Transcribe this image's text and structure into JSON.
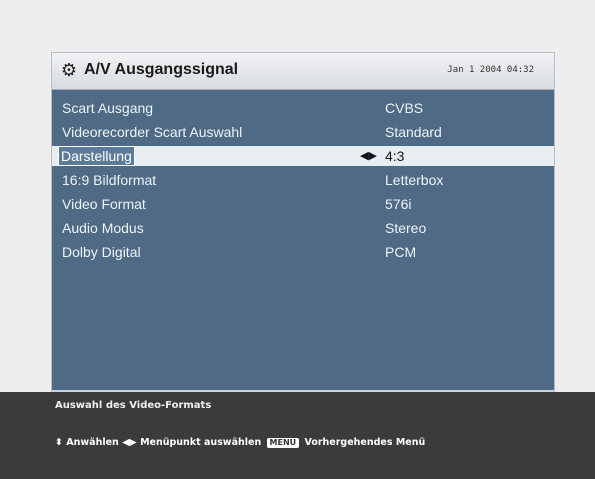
{
  "header": {
    "title": "A/V Ausgangssignal",
    "clock": "Jan 1 2004 04:32",
    "icon": "gear-icon"
  },
  "settings": [
    {
      "label": "Scart Ausgang",
      "value": "CVBS",
      "selected": false
    },
    {
      "label": "Videorecorder Scart Auswahl",
      "value": "Standard",
      "selected": false
    },
    {
      "label": "Darstellung",
      "value": "4:3",
      "selected": true
    },
    {
      "label": "16:9 Bildformat",
      "value": "Letterbox",
      "selected": false
    },
    {
      "label": "Video Format",
      "value": "576i",
      "selected": false
    },
    {
      "label": "Audio Modus",
      "value": "Stereo",
      "selected": false
    },
    {
      "label": "Dolby Digital",
      "value": "PCM",
      "selected": false
    }
  ],
  "footer": {
    "hint": "Auswahl des Video-Formats",
    "legend": {
      "select_label": "Anwählen",
      "move_label": "Menüpunkt auswählen",
      "menu_key": "MENU",
      "back_label": "Vorhergehendes Menü"
    }
  },
  "colors": {
    "panel_bg": "#4e6a84",
    "selected_bg": "#e8edf1",
    "footer_bg": "#3b3b3b"
  }
}
